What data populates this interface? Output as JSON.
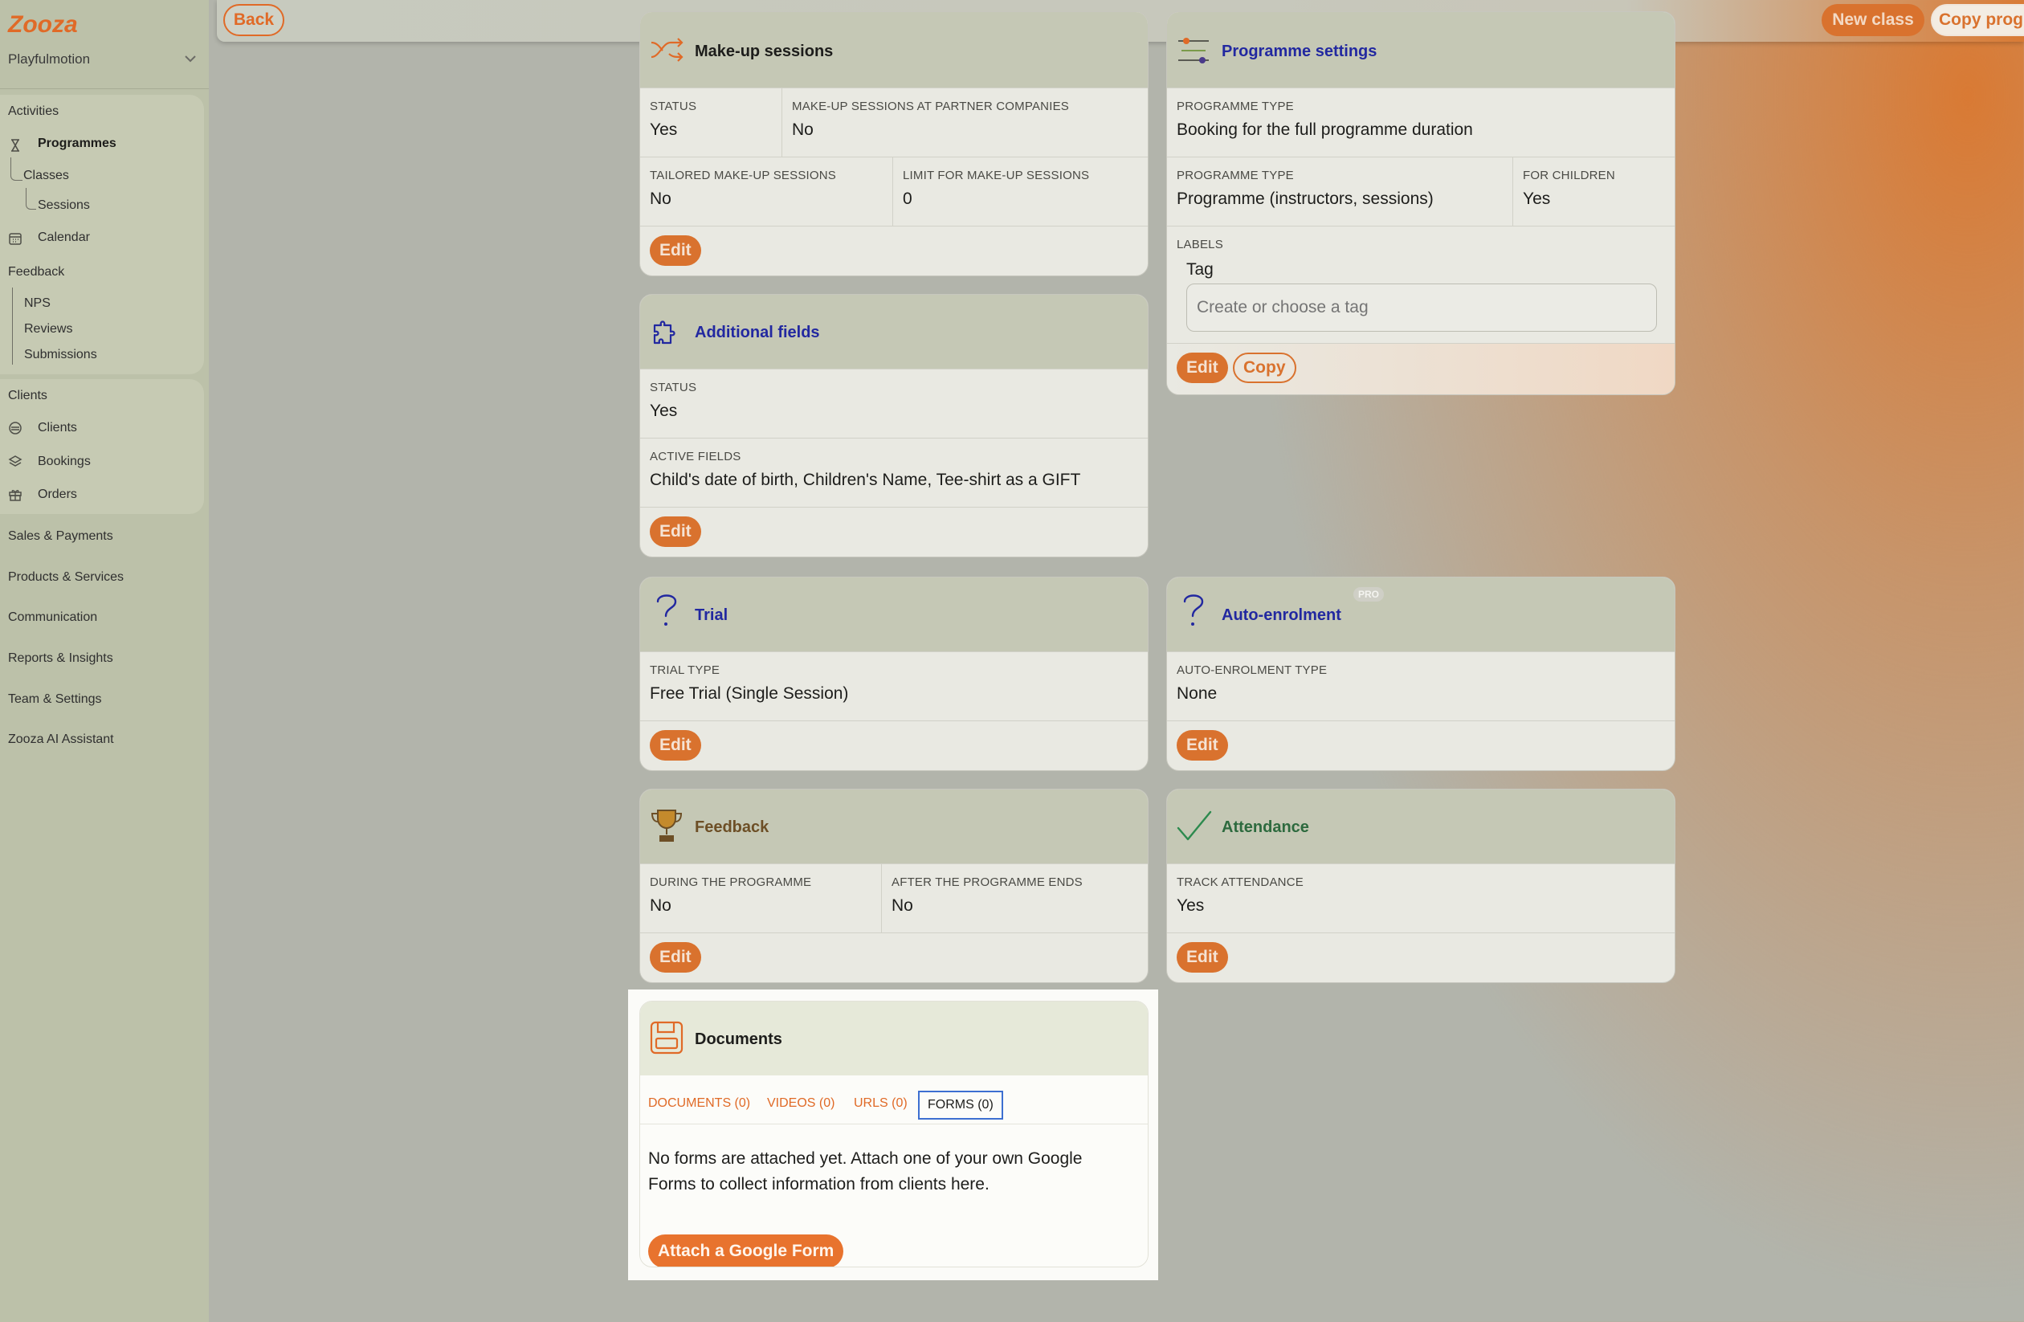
{
  "colors": {
    "accent": "#e06a27",
    "blue_title": "#2228a0",
    "sidebar_bg": "#bcc1a9"
  },
  "sidebar": {
    "org": "Playfulmotion",
    "sections": [
      {
        "label": "Activities"
      },
      {
        "label": "Feedback"
      },
      {
        "label": "Clients"
      },
      {
        "label": "Sales & Payments"
      },
      {
        "label": "Products & Services"
      },
      {
        "label": "Communication"
      },
      {
        "label": "Reports & Insights"
      },
      {
        "label": "Team & Settings"
      },
      {
        "label": "Zooza AI Assistant"
      }
    ],
    "items": {
      "programmes": "Programmes",
      "classes": "Classes",
      "sessions": "Sessions",
      "calendar": "Calendar",
      "nps": "NPS",
      "reviews": "Reviews",
      "submissions": "Submissions",
      "clients": "Clients",
      "bookings": "Bookings",
      "orders": "Orders"
    }
  },
  "topbar": {
    "back": "Back",
    "new_class": "New class",
    "copy_programme": "Copy prog"
  },
  "common": {
    "edit": "Edit",
    "copy": "Copy"
  },
  "makeup": {
    "title": "Make-up sessions",
    "status_label": "STATUS",
    "status_value": "Yes",
    "partner_label": "MAKE-UP SESSIONS AT PARTNER COMPANIES",
    "partner_value": "No",
    "tailored_label": "TAILORED MAKE-UP SESSIONS",
    "tailored_value": "No",
    "limit_label": "LIMIT FOR MAKE-UP SESSIONS",
    "limit_value": "0"
  },
  "programme_settings": {
    "title": "Programme settings",
    "type1_label": "PROGRAMME TYPE",
    "type1_value": "Booking for the full programme duration",
    "type2_label": "PROGRAMME TYPE",
    "type2_value": "Programme (instructors, sessions)",
    "children_label": "FOR CHILDREN",
    "children_value": "Yes",
    "labels_label": "LABELS",
    "tag_label": "Tag",
    "tag_placeholder": "Create or choose a tag"
  },
  "additional_fields": {
    "title": "Additional fields",
    "status_label": "STATUS",
    "status_value": "Yes",
    "active_label": "ACTIVE FIELDS",
    "active_value": "Child's date of birth, Children's Name, Tee-shirt as a GIFT"
  },
  "trial": {
    "title": "Trial",
    "type_label": "TRIAL TYPE",
    "type_value": "Free Trial (Single Session)"
  },
  "auto_enrolment": {
    "title": "Auto-enrolment",
    "badge": "PRO",
    "type_label": "AUTO-ENROLMENT TYPE",
    "type_value": "None"
  },
  "feedback": {
    "title": "Feedback",
    "during_label": "DURING THE PROGRAMME",
    "during_value": "No",
    "after_label": "AFTER THE PROGRAMME ENDS",
    "after_value": "No"
  },
  "attendance": {
    "title": "Attendance",
    "track_label": "TRACK ATTENDANCE",
    "track_value": "Yes"
  },
  "documents": {
    "title": "Documents",
    "tabs": [
      "DOCUMENTS (0)",
      "VIDEOS (0)",
      "URLS (0)",
      "FORMS (0)"
    ],
    "message": "No forms are attached yet. Attach one of your own Google Forms to collect information from clients here.",
    "attach_button": "Attach a Google Form"
  }
}
